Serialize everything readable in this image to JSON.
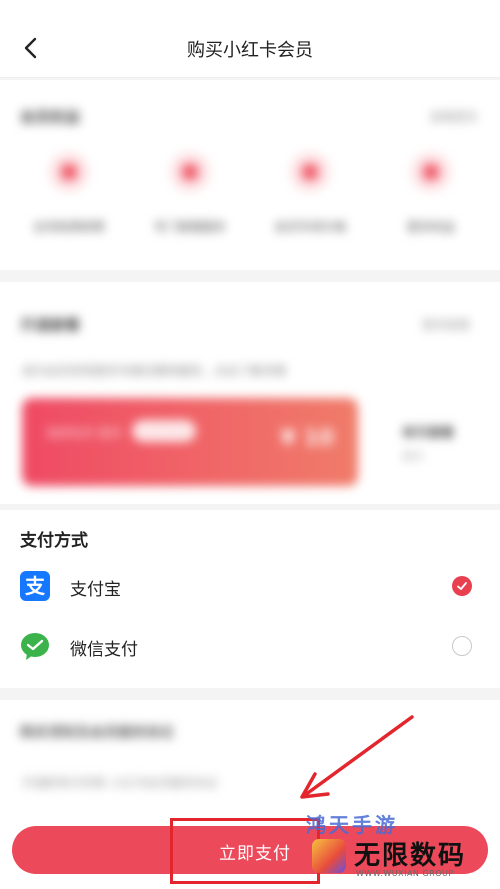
{
  "nav": {
    "title": "购买小红卡会员"
  },
  "blurred_top": {
    "heading": "会员权益",
    "more": "查看更多",
    "benefits": [
      "全场免费邮费",
      "专门客服服务",
      "会员专享价格",
      "更多权益"
    ]
  },
  "blurred_card": {
    "heading": "开通套餐",
    "more": "更多套餐",
    "note": "成为会员享受更多专属优惠和服务，点击了解详情",
    "promo_text": "连续包月 首月",
    "promo_price": "¥ 10",
    "side_title": "单月套餐",
    "side_sub": "原价"
  },
  "payment": {
    "title": "支付方式",
    "methods": [
      {
        "label": "支付宝",
        "selected": true
      },
      {
        "label": "微信支付",
        "selected": false
      }
    ]
  },
  "blurred_bottom": {
    "line1": "购买须知及会员服务协议",
    "line2": "开通即表示同意 小红书会员服务协议"
  },
  "footer": {
    "pay_button": "立即支付"
  },
  "annotation": {
    "highlight_color": "#e3262e"
  },
  "watermark": {
    "top_text": "鸿天手游",
    "main_text": "无限数码",
    "sub_text": "WWW.WUXIAN GROUP"
  },
  "colors": {
    "accent": "#ec4a5b",
    "alipay": "#1677ff",
    "wechat": "#3bb34a"
  }
}
